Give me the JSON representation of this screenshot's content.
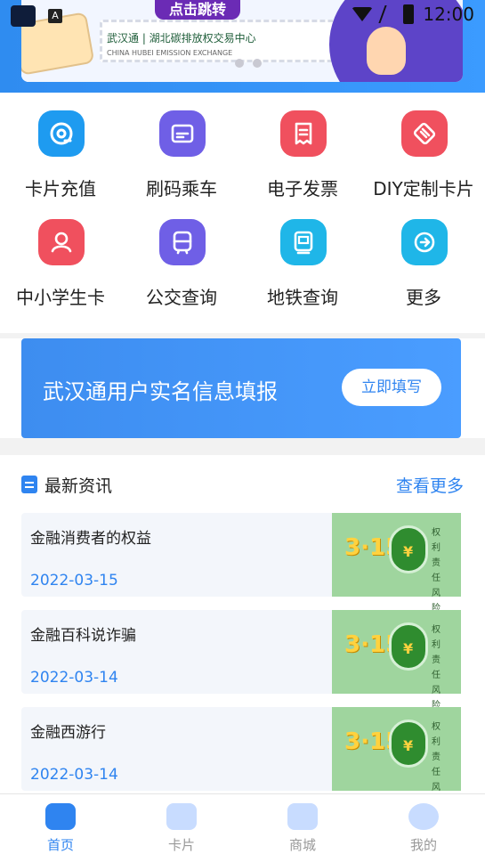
{
  "statusbar": {
    "time": "12:00"
  },
  "banner": {
    "tag": "点击跳转",
    "logo_text": "武汉通 | 湖北碳排放权交易中心",
    "logo_sub": "CHINA HUBEI EMISSION EXCHANGE"
  },
  "grid": [
    {
      "label": "卡片充值",
      "icon": "wallet-icon",
      "color": "#1e9bf0"
    },
    {
      "label": "刷码乘车",
      "icon": "card-icon",
      "color": "#6f5fe6"
    },
    {
      "label": "电子发票",
      "icon": "invoice-icon",
      "color": "#f0505e"
    },
    {
      "label": "DIY定制卡片",
      "icon": "tag-icon",
      "color": "#f0505e"
    },
    {
      "label": "中小学生卡",
      "icon": "student-icon",
      "color": "#f0505e"
    },
    {
      "label": "公交查询",
      "icon": "bus-icon",
      "color": "#6f5fe6"
    },
    {
      "label": "地铁查询",
      "icon": "metro-icon",
      "color": "#1fb6e8"
    },
    {
      "label": "更多",
      "icon": "more-icon",
      "color": "#1fb6e8"
    }
  ],
  "realname": {
    "text": "武汉通用户实名信息填报",
    "button": "立即填写"
  },
  "news": {
    "title": "最新资讯",
    "more": "查看更多",
    "items": [
      {
        "title": "金融消费者的权益",
        "date": "2022-03-15",
        "thumb_num": "3·15",
        "thumb_words": "权利责任风险"
      },
      {
        "title": "金融百科说诈骗",
        "date": "2022-03-14",
        "thumb_num": "3·15",
        "thumb_words": "权利责任风险"
      },
      {
        "title": "金融西游行",
        "date": "2022-03-14",
        "thumb_num": "3·15",
        "thumb_words": "权利责任风险"
      }
    ]
  },
  "nav": [
    {
      "label": "首页",
      "active": true
    },
    {
      "label": "卡片",
      "active": false
    },
    {
      "label": "商城",
      "active": false
    },
    {
      "label": "我的",
      "active": false
    }
  ]
}
